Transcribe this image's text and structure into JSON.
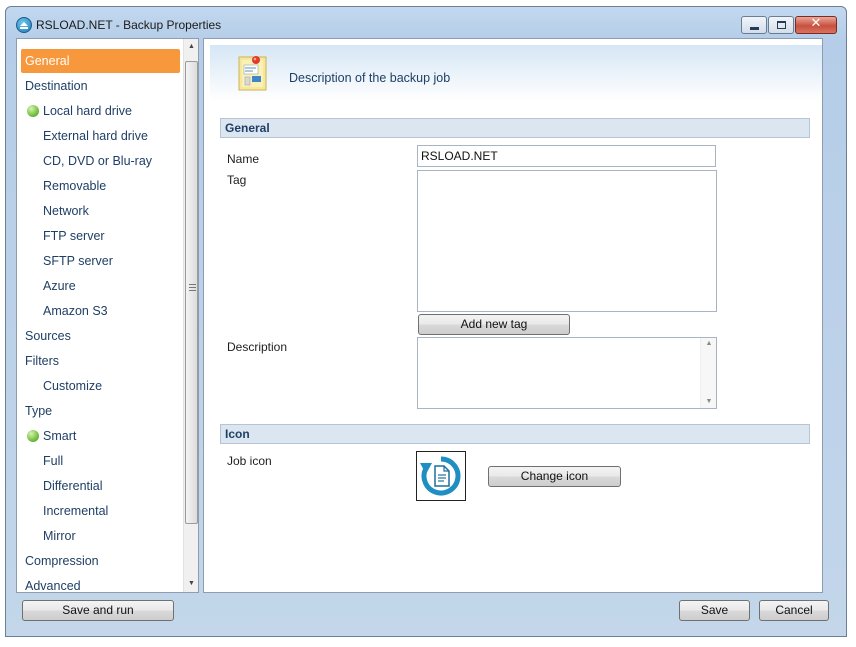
{
  "window": {
    "title": "RSLOAD.NET - Backup Properties",
    "controls": {
      "minimize": "minimize-icon",
      "maximize": "maximize-icon",
      "close_glyph": "✕"
    }
  },
  "sidebar": {
    "items": [
      {
        "label": "General",
        "selected": true,
        "indent": false,
        "status": ""
      },
      {
        "label": "Destination",
        "indent": false,
        "status": ""
      },
      {
        "label": "Local hard drive",
        "indent": true,
        "status": "active"
      },
      {
        "label": "External hard drive",
        "indent": true,
        "status": ""
      },
      {
        "label": "CD, DVD or Blu-ray",
        "indent": true,
        "status": ""
      },
      {
        "label": "Removable",
        "indent": true,
        "status": ""
      },
      {
        "label": "Network",
        "indent": true,
        "status": ""
      },
      {
        "label": "FTP server",
        "indent": true,
        "status": ""
      },
      {
        "label": "SFTP server",
        "indent": true,
        "status": ""
      },
      {
        "label": "Azure",
        "indent": true,
        "status": ""
      },
      {
        "label": "Amazon S3",
        "indent": true,
        "status": ""
      },
      {
        "label": "Sources",
        "indent": false,
        "status": ""
      },
      {
        "label": "Filters",
        "indent": false,
        "status": ""
      },
      {
        "label": "Customize",
        "indent": true,
        "status": ""
      },
      {
        "label": "Type",
        "indent": false,
        "status": ""
      },
      {
        "label": "Smart",
        "indent": true,
        "status": "active"
      },
      {
        "label": "Full",
        "indent": true,
        "status": ""
      },
      {
        "label": "Differential",
        "indent": true,
        "status": ""
      },
      {
        "label": "Incremental",
        "indent": true,
        "status": ""
      },
      {
        "label": "Mirror",
        "indent": true,
        "status": ""
      },
      {
        "label": "Compression",
        "indent": false,
        "status": ""
      },
      {
        "label": "Advanced",
        "indent": false,
        "status": ""
      }
    ],
    "selected_color": "#f7983c"
  },
  "content": {
    "header": {
      "text": "Description of the backup job",
      "icon": "notepad-pin-icon"
    },
    "general_section": {
      "title": "General",
      "name_label": "Name",
      "name_value": "RSLOAD.NET",
      "tag_label": "Tag",
      "add_tag_button": "Add new tag",
      "description_label": "Description",
      "description_value": ""
    },
    "icon_section": {
      "title": "Icon",
      "job_icon_label": "Job icon",
      "job_icon": "backup-restore-icon",
      "change_icon_button": "Change icon"
    }
  },
  "footer": {
    "save_and_run": "Save and run",
    "save": "Save",
    "cancel": "Cancel"
  },
  "colors": {
    "accent": "#f7983c",
    "title_bar": "#b5cde8",
    "label_text": "#1f3f66"
  }
}
